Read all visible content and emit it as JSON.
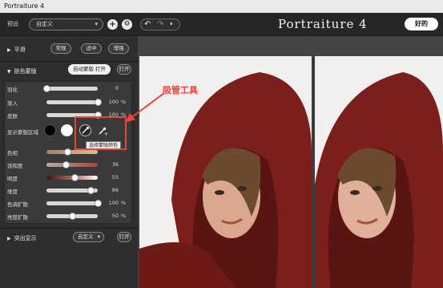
{
  "window": {
    "title": "Portraiture 4"
  },
  "toolbar": {
    "preset_label": "预设",
    "preset_value": "自定义",
    "brand": "Portraiture 4",
    "ok_label": "好的"
  },
  "smoothing": {
    "title": "平滑",
    "buttons": [
      "常规",
      "适中",
      "增强"
    ]
  },
  "skin_mask": {
    "title": "肤色蒙版",
    "auto_mask_label": "自动蒙版 打开",
    "toggle_label": "打开",
    "sliders_top": [
      {
        "label": "羽化",
        "value": "0",
        "unit": "",
        "level": 0.0
      },
      {
        "label": "渐入",
        "value": "100",
        "unit": "%",
        "level": 1.0
      },
      {
        "label": "皮肤",
        "value": "100",
        "unit": "%",
        "level": 1.0
      }
    ],
    "show_mask_label": "显示蒙版区域",
    "tooltip": "选择蒙版颜色",
    "sliders_bottom": [
      {
        "label": "色相",
        "value": "",
        "unit": "",
        "level": 0.4
      },
      {
        "label": "饱和度",
        "value": "36",
        "unit": "",
        "level": 0.38
      },
      {
        "label": "明度",
        "value": "55",
        "unit": "",
        "level": 0.55
      },
      {
        "label": "维度",
        "value": "86",
        "unit": "",
        "level": 0.86
      },
      {
        "label": "色调扩散",
        "value": "100",
        "unit": "%",
        "level": 1.0
      },
      {
        "label": "亮度扩散",
        "value": "50",
        "unit": "%",
        "level": 0.5
      }
    ]
  },
  "highlight": {
    "title": "突出显示",
    "preset_value": "自定义",
    "toggle_label": "打开"
  },
  "annotation": {
    "text": "吸管工具"
  },
  "colors": {
    "accent_red": "#e8453a",
    "panel_bg": "#2e2e2e"
  }
}
